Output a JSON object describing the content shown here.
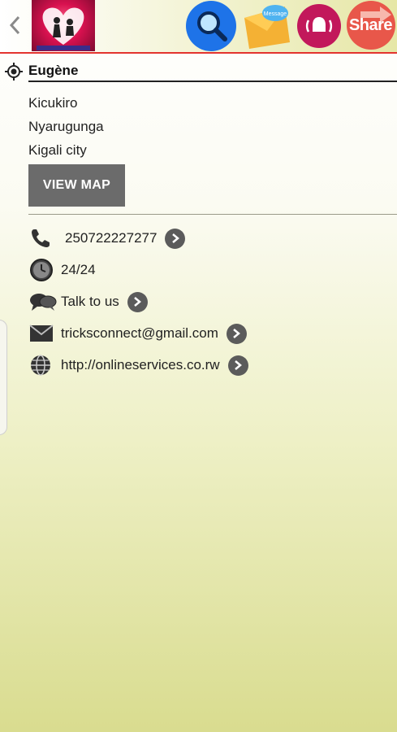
{
  "header": {
    "back_label": "<",
    "icons": [
      "back-chevron-icon",
      "search-icon",
      "message-icon",
      "alarm-icon",
      "share-icon"
    ],
    "message_badge": "Message",
    "share_label": "Share"
  },
  "contact": {
    "name": "Eugène",
    "address": [
      "Kicukiro",
      "Nyarugunga",
      "Kigali city"
    ],
    "view_map_label": "VIEW MAP",
    "phone": "250722227277",
    "hours": "24/24",
    "talk": "Talk to us",
    "email": "tricksconnect@gmail.com",
    "website": "http://onlineservices.co.rw"
  },
  "colors": {
    "accent_red": "#e3342f",
    "search_blue": "#1e73e8",
    "alarm_crimson": "#c2185b",
    "share_red": "#e8574a",
    "button_gray": "#6b6b6b"
  }
}
